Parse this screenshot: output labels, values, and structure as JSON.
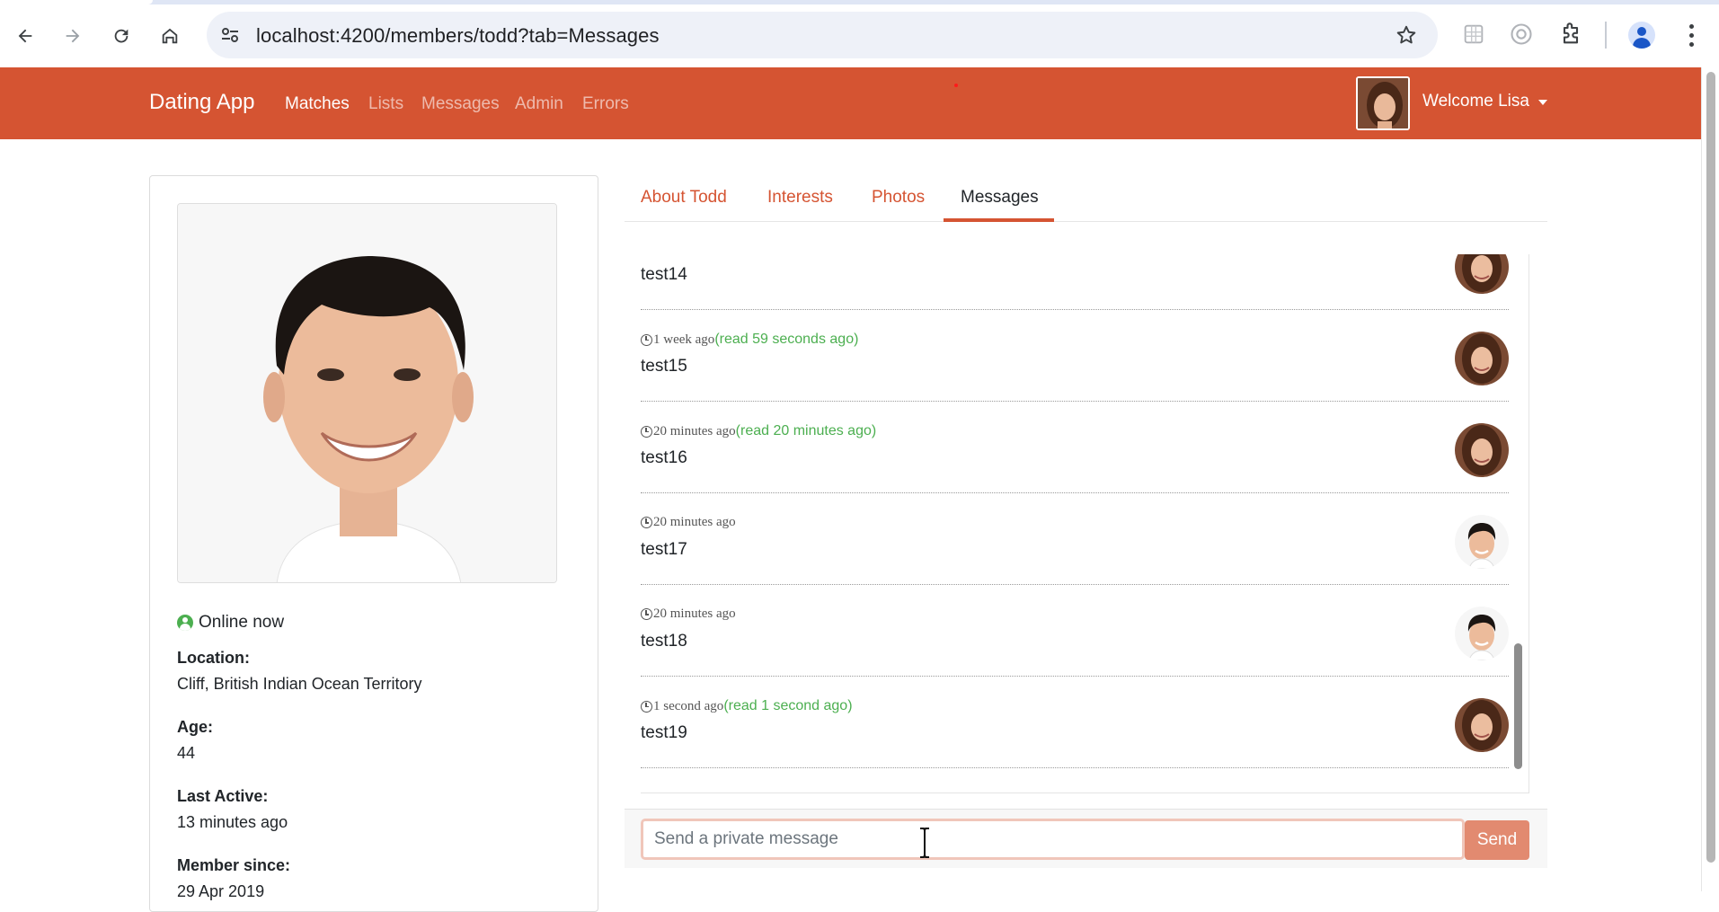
{
  "browser": {
    "url": "localhost:4200/members/todd?tab=Messages"
  },
  "navbar": {
    "brand": "Dating App",
    "links": [
      "Matches",
      "Lists",
      "Messages",
      "Admin",
      "Errors"
    ],
    "active_link": "Matches",
    "welcome": "Welcome Lisa",
    "color": "#d55432"
  },
  "profile": {
    "status": "Online now",
    "location_label": "Location:",
    "location": "Cliff, British Indian Ocean Territory",
    "age_label": "Age:",
    "age": "44",
    "last_active_label": "Last Active:",
    "last_active": "13 minutes ago",
    "member_since_label": "Member since:",
    "member_since": "29 Apr 2019"
  },
  "tabs": {
    "items": [
      "About Todd",
      "Interests",
      "Photos",
      "Messages"
    ],
    "active": "Messages"
  },
  "messages": [
    {
      "time": "",
      "read": "",
      "text": "test14",
      "sender": "lisa"
    },
    {
      "time": "1 week ago",
      "read": "(read 59 seconds ago)",
      "text": "test15",
      "sender": "lisa"
    },
    {
      "time": "20 minutes ago",
      "read": "(read 20 minutes ago)",
      "text": "test16",
      "sender": "lisa"
    },
    {
      "time": "20 minutes ago",
      "read": "",
      "text": "test17",
      "sender": "todd"
    },
    {
      "time": "20 minutes ago",
      "read": "",
      "text": "test18",
      "sender": "todd"
    },
    {
      "time": "1 second ago",
      "read": "(read 1 second ago)",
      "text": "test19",
      "sender": "lisa"
    }
  ],
  "composer": {
    "placeholder": "Send a private message",
    "send_label": "Send"
  }
}
